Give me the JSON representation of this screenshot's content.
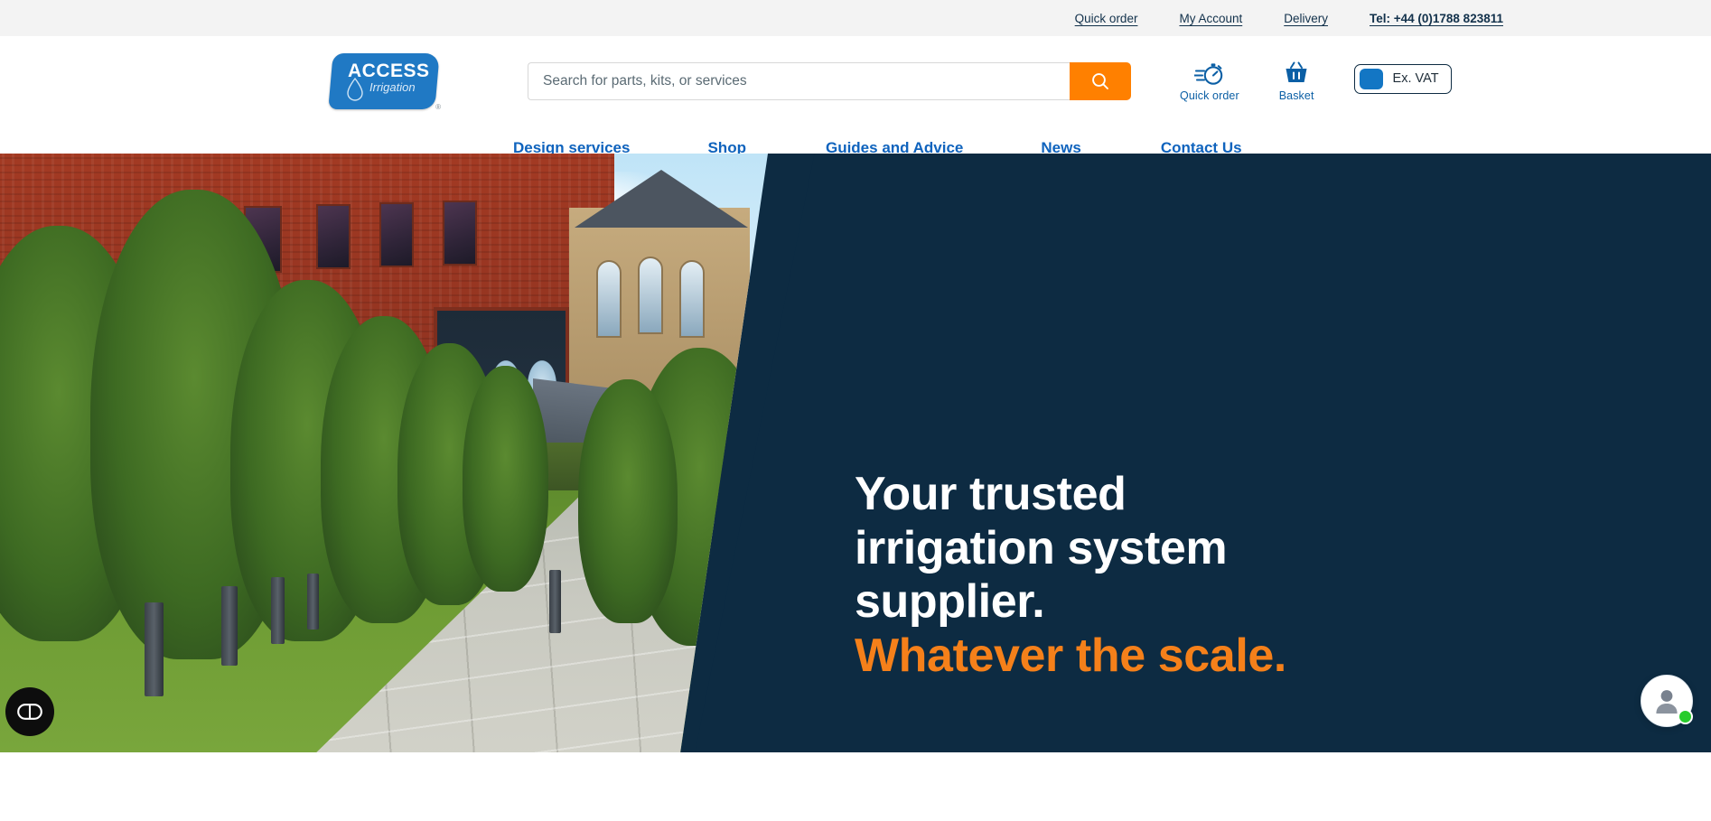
{
  "topbar": {
    "links": [
      {
        "label": "Quick order",
        "name": "quick-order"
      },
      {
        "label": "My Account",
        "name": "my-account"
      },
      {
        "label": "Delivery",
        "name": "delivery"
      },
      {
        "label": "Tel: +44 (0)1788 823811",
        "name": "telephone"
      }
    ]
  },
  "header": {
    "logo": {
      "brand": "ACCESS",
      "sub": "Irrigation",
      "trademark": "®",
      "icon": "water-droplet-icon"
    },
    "search": {
      "placeholder": "Search for parts, kits, or services",
      "value": "",
      "button_icon": "search-icon"
    },
    "actions": [
      {
        "label": "Quick order",
        "icon": "stopwatch-icon"
      },
      {
        "label": "Basket",
        "icon": "basket-icon"
      }
    ],
    "vat_toggle": {
      "label": "Ex. VAT",
      "state": "off"
    }
  },
  "nav": {
    "items": [
      {
        "label": "Design services"
      },
      {
        "label": "Shop"
      },
      {
        "label": "Guides and Advice"
      },
      {
        "label": "News"
      },
      {
        "label": "Contact Us"
      }
    ]
  },
  "hero": {
    "heading_line1": "Your trusted",
    "heading_line2": "irrigation system",
    "heading_line3": "supplier.",
    "heading_accent": "Whatever the scale.",
    "image_alt": "Landscaped garden path with trees beside a red brick building"
  },
  "widgets": {
    "accessibility": {
      "icon": "accessibility-icon",
      "label": "Accessibility options"
    },
    "chat": {
      "icon": "user-avatar-icon",
      "status": "online"
    }
  },
  "colors": {
    "brand_blue": "#0f63bd",
    "logo_blue": "#2079c4",
    "accent_orange": "#f5801a",
    "search_orange": "#ff8000",
    "hero_navy": "#0d2b42",
    "topbar_grey": "#f3f3f3",
    "online_green": "#27cc2b"
  }
}
